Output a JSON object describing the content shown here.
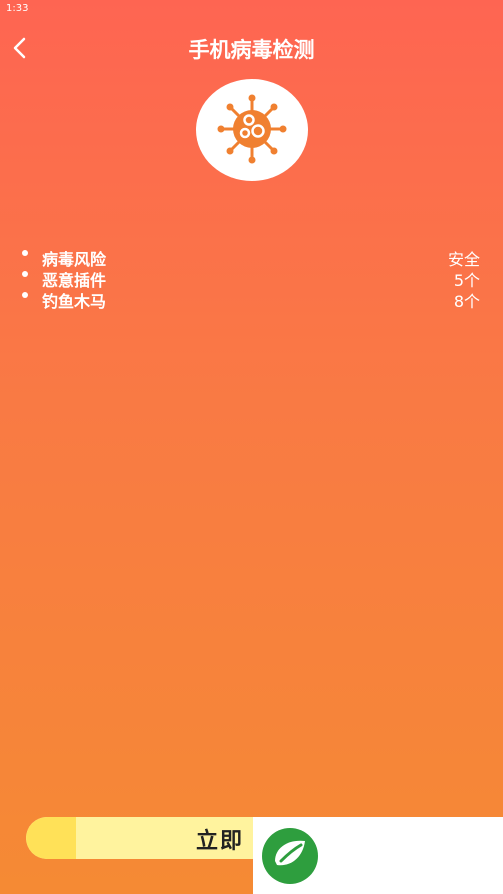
{
  "status_bar": {
    "time": "1:33"
  },
  "header": {
    "title": "手机病毒检测"
  },
  "items": [
    {
      "label": "病毒风险",
      "value": "安全"
    },
    {
      "label": "恶意插件",
      "value": "5个"
    },
    {
      "label": "钓鱼木马",
      "value": "8个"
    }
  ],
  "scan_button": {
    "label": "立即"
  },
  "colors": {
    "gradient_top": "#FE6552",
    "gradient_bottom": "#F58A34",
    "button_fill": "#FFF39E",
    "accent": "#F08030"
  }
}
